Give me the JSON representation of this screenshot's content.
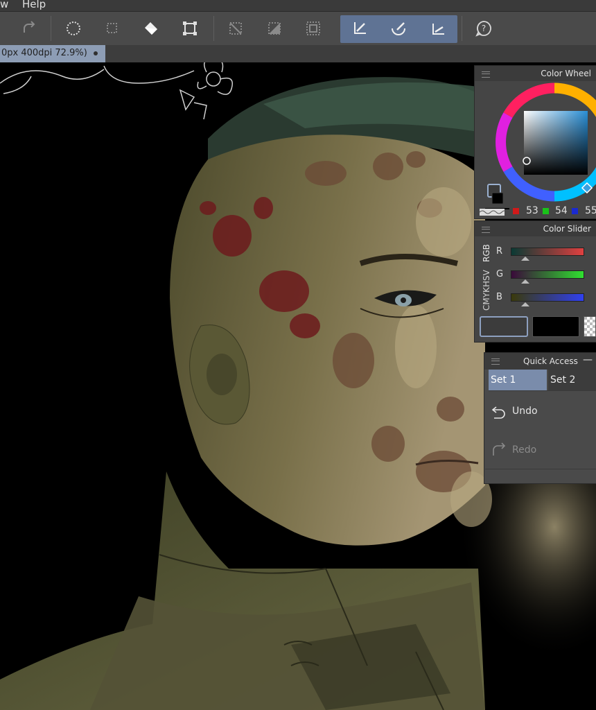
{
  "menu": {
    "items": [
      "w",
      "Help"
    ]
  },
  "toolbar": {
    "buttons": [
      "redo-icon",
      "selection-lasso-icon",
      "selection-marquee-icon",
      "fill-icon",
      "transform-icon",
      "deselect-icon",
      "gradient-icon",
      "frame-border-icon",
      "pen-tool-icon",
      "brush-tool-icon",
      "eraser-tool-icon",
      "help-icon"
    ],
    "active_group_color": "#5f7394"
  },
  "document_tab": {
    "label": "0px 400dpi 72.9%)"
  },
  "color_wheel": {
    "title": "Color Wheel",
    "r": "53",
    "g": "54",
    "b": "55",
    "hue_color": "#3aa0e0"
  },
  "color_slider": {
    "title": "Color Slider",
    "tabs": [
      "RGB",
      "HSV",
      "CMYK"
    ],
    "labels": {
      "r": "R",
      "g": "G",
      "b": "B"
    }
  },
  "quick_access": {
    "title": "Quick Access",
    "minimize": "—",
    "tabs": [
      "Set 1",
      "Set 2"
    ],
    "actions": [
      {
        "label": "Undo",
        "enabled": true
      },
      {
        "label": "Redo",
        "enabled": false
      }
    ]
  }
}
